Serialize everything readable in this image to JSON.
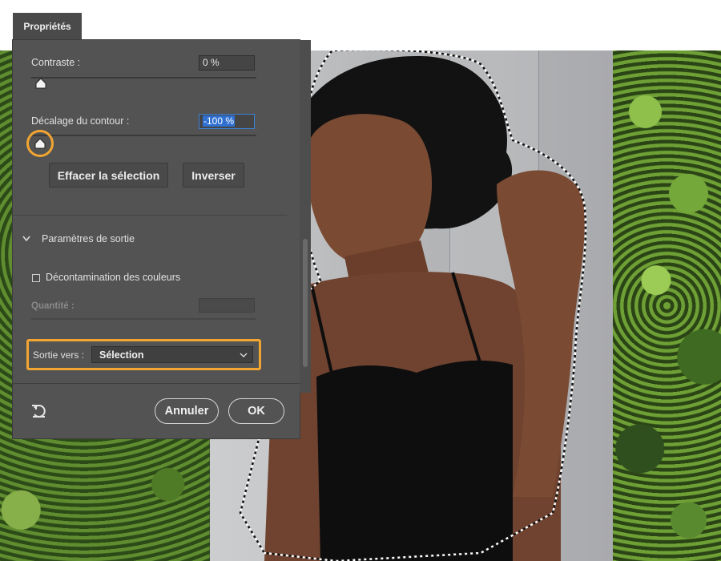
{
  "panel": {
    "tab_title": "Propriétés",
    "contrast": {
      "label": "Contraste :",
      "value": "0 %",
      "level_fraction": 0.0
    },
    "edge_shift": {
      "label": "Décalage du contour :",
      "value": "-100 %",
      "level_fraction": 0.0
    },
    "buttons": {
      "clear_selection": "Effacer la sélection",
      "invert": "Inverser"
    },
    "output_section": {
      "title": "Paramètres de sortie",
      "decontaminate_label": "Décontamination des couleurs",
      "decontaminate_checked": false,
      "amount_label": "Quantité :",
      "amount_value": "",
      "output_to_label": "Sortie vers :",
      "output_to_value": "Sélection"
    },
    "footer": {
      "cancel": "Annuler",
      "ok": "OK",
      "reset_icon": "reset-icon"
    }
  },
  "colors": {
    "panel_bg": "#535353",
    "accent_highlight": "#f2a531",
    "active_field": "#2f6fd0"
  }
}
